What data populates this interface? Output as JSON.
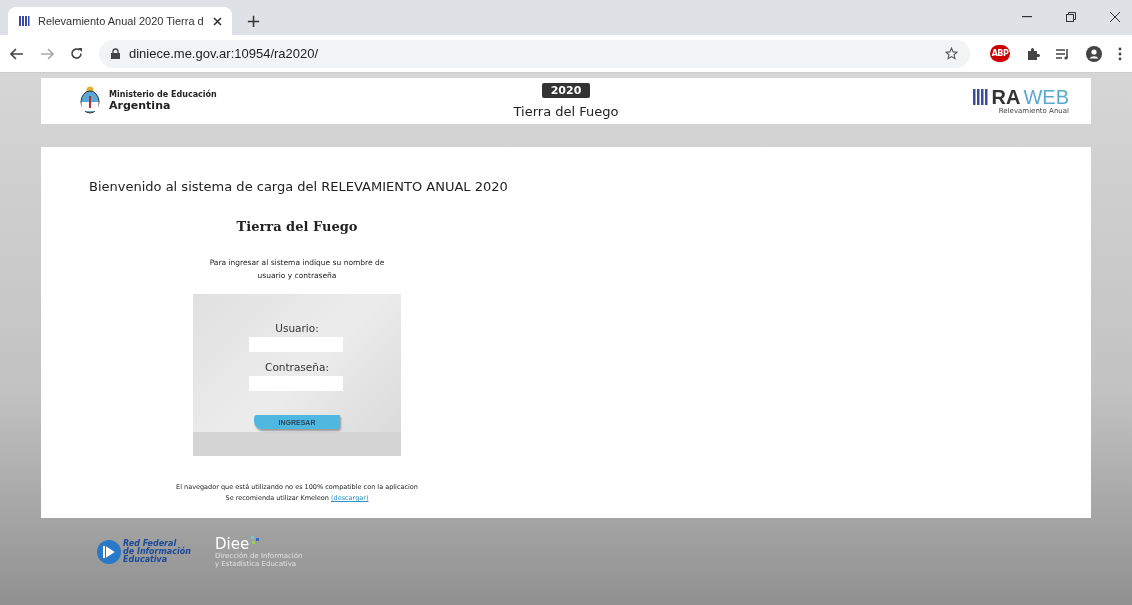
{
  "browser": {
    "tab_title": "Relevamiento Anual 2020 Tierra d",
    "new_tab": "+",
    "url": "diniece.me.gov.ar:10954/ra2020/",
    "extension_badge": "ABP"
  },
  "header": {
    "ministry_line1": "Ministerio de Educación",
    "ministry_line2": "Argentina",
    "year_badge": "2020",
    "province": "Tierra del Fuego",
    "brand_ra": "RA",
    "brand_web": "WEB",
    "brand_subtitle": "Relevamiento Anual"
  },
  "welcome": "Bienvenido al sistema de carga del RELEVAMIENTO ANUAL 2020",
  "province_title": "Tierra del Fuego",
  "instructions": "Para ingresar al sistema indique su nombre de usuario y contraseña",
  "login": {
    "fields": [
      {
        "label": "Usuario:"
      },
      {
        "label": "Contraseña:"
      }
    ],
    "submit": "INGRESAR"
  },
  "notice": {
    "line1": "El navegador que está utilizando no es 100% compatible con la aplicacion",
    "line2": "Se recomienda utilizar Kmeleon",
    "link": "(descargar)"
  },
  "footer": {
    "rfie_lines": [
      "Red Federal",
      "de Información",
      "Educativa"
    ],
    "diee": "Diee",
    "diee_sub": [
      "Dirección de Información",
      "y Estadística Educativa"
    ]
  }
}
